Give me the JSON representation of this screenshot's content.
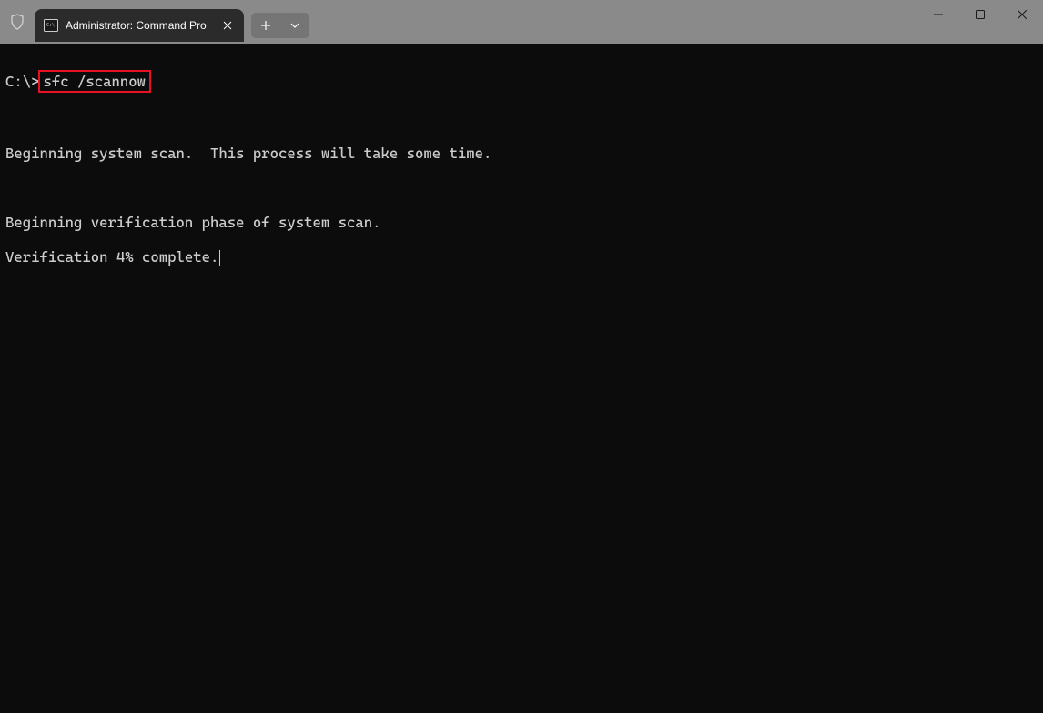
{
  "titlebar": {
    "tab_title": "Administrator: Command Pro",
    "shield_label": "shield-icon"
  },
  "terminal": {
    "prompt": "C:\\>",
    "command": "sfc /scannow",
    "line1": "",
    "line2": "Beginning system scan.  This process will take some time.",
    "line3": "",
    "line4": "Beginning verification phase of system scan.",
    "line5": "Verification 4% complete."
  }
}
